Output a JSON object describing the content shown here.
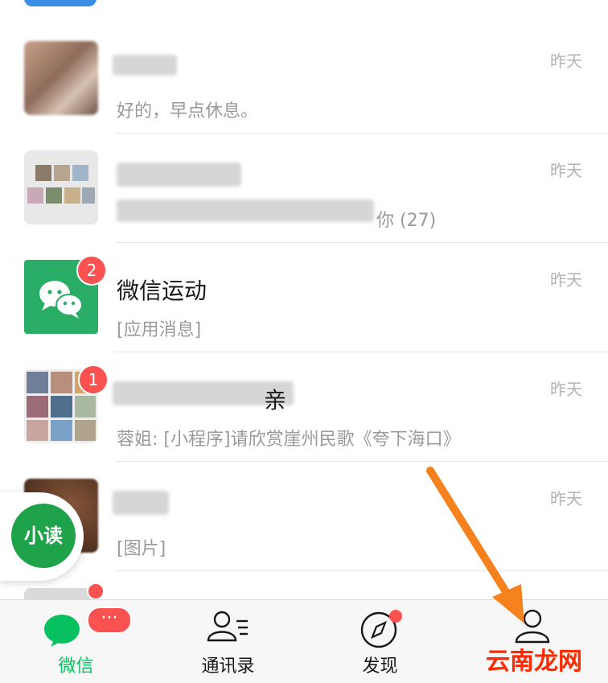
{
  "chats": [
    {
      "preview": "好的，早点休息。",
      "time": "昨天"
    },
    {
      "preview": "你 (27)",
      "time": "昨天"
    },
    {
      "name": "微信运动",
      "preview": "[应用消息]",
      "time": "昨天",
      "badge": "2"
    },
    {
      "name": "亲",
      "preview": "蓉姐: [小程序]请欣赏崖州民歌《夸下海口》",
      "time": "昨天",
      "badge": "1"
    },
    {
      "preview": "[图片]",
      "time": "昨天"
    }
  ],
  "floating_widget": {
    "label": "小读"
  },
  "tabbar": {
    "tabs": [
      {
        "label": "微信",
        "icon": "chat-bubbles-icon",
        "badge": "···"
      },
      {
        "label": "通讯录",
        "icon": "contacts-icon"
      },
      {
        "label": "发现",
        "icon": "compass-icon"
      },
      {
        "label": "",
        "icon": "person-icon"
      }
    ]
  },
  "watermark": "云南龙网",
  "colors": {
    "accent": "#07c160",
    "badge": "#fa5151",
    "arrow": "#f5821f"
  }
}
